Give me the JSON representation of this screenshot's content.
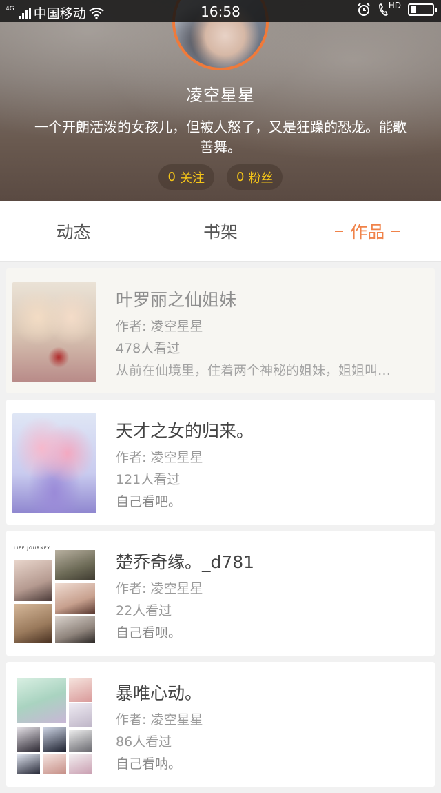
{
  "status_bar": {
    "network": "4G",
    "carrier": "中国移动",
    "time": "16:58",
    "hd": "HD",
    "battery_level": 0.25
  },
  "profile": {
    "nickname": "凌空星星",
    "bio": "一个开朗活泼的女孩儿，但被人怒了，又是狂躁的恐龙。能歌善舞。",
    "following_count": "0",
    "following_label": "关注",
    "followers_count": "0",
    "followers_label": "粉丝"
  },
  "tabs": [
    {
      "label": "动态",
      "active": false
    },
    {
      "label": "书架",
      "active": false
    },
    {
      "label": "作品",
      "active": true
    }
  ],
  "works": [
    {
      "title": "叶罗丽之仙姐妹",
      "author": "作者: 凌空星星",
      "views": "478人看过",
      "desc": "从前在仙境里，住着两个神秘的姐妹，姐姐叫…"
    },
    {
      "title": "天才之女的归来。",
      "author": "作者: 凌空星星",
      "views": "121人看过",
      "desc": "自己看吧。"
    },
    {
      "title": "楚乔奇缘。_d781",
      "author": "作者: 凌空星星",
      "views": "22人看过",
      "desc": "自己看呗。",
      "cover_text": "LIFE JOURNEY"
    },
    {
      "title": "暴唯心动。",
      "author": "作者: 凌空星星",
      "views": "86人看过",
      "desc": "自己看呐。"
    }
  ],
  "colors": {
    "accent": "#f0834a",
    "count_text": "#f5c518",
    "avatar_ring": "#f07a3a"
  }
}
